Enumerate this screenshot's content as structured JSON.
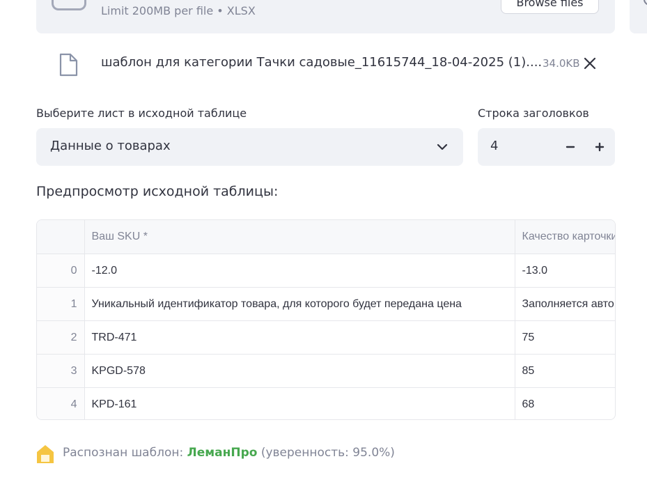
{
  "uploader": {
    "limit_text": "Limit 200MB per file • XLSX",
    "browse_label": "Browse files"
  },
  "file": {
    "name": "шаблон для категории Тачки садовые_11615744_18-04-2025 (1)....",
    "size": "34.0KB"
  },
  "sheet_select": {
    "label": "Выберите лист в исходной таблице",
    "value": "Данные о товарах"
  },
  "header_row": {
    "label": "Строка заголовков",
    "value": "4",
    "minus": "−",
    "plus": "+"
  },
  "preview": {
    "title": "Предпросмотр исходной таблицы:",
    "columns": [
      "",
      "Ваш SKU *",
      "Качество карточки"
    ],
    "rows": [
      [
        "0",
        "-12.0",
        "-13.0"
      ],
      [
        "1",
        "Уникальный идентификатор товара, для которого будет передана цена",
        "Заполняется автоматически"
      ],
      [
        "2",
        "TRD-471",
        "75"
      ],
      [
        "3",
        "KPGD-578",
        "85"
      ],
      [
        "4",
        "KPD-161",
        "68"
      ]
    ]
  },
  "template": {
    "prefix": "Распознан шаблон: ",
    "name": "ЛеманПро",
    "suffix": " (уверенность: 95.0%)"
  },
  "colors": {
    "accent_green": "#47a84f",
    "icon_yellow": "#f5c542",
    "surface": "#f0f2f6"
  },
  "icons": {
    "upload": "cloud-upload-icon",
    "file": "file-icon",
    "remove": "close-icon",
    "dropdown": "chevron-down-icon",
    "template": "house-icon"
  }
}
